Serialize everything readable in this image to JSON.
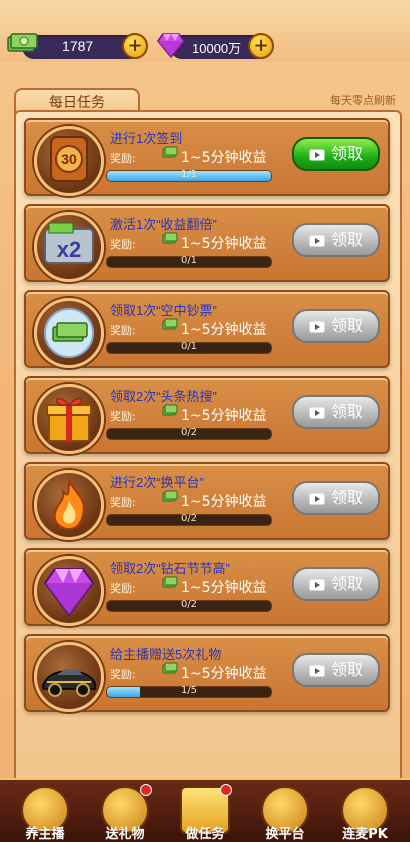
{
  "currency": {
    "cash_value": "1787",
    "gem_value": "10000万"
  },
  "tab": {
    "label": "每日任务"
  },
  "refresh_note": "每天零点刷新",
  "reward_label": "奖励:",
  "tasks": [
    {
      "title": "进行1次签到",
      "reward": "1~5分钟收益",
      "progress_text": "1/1",
      "progress": 1.0,
      "button": "领取",
      "button_state": "active",
      "icon": "sign-in-30-icon"
    },
    {
      "title": "激活1次“收益翻倍”",
      "reward": "1~5分钟收益",
      "progress_text": "0/1",
      "progress": 0,
      "button": "领取",
      "button_state": "inactive",
      "icon": "double-x2-icon"
    },
    {
      "title": "领取1次“空中钞票”",
      "reward": "1~5分钟收益",
      "progress_text": "0/1",
      "progress": 0,
      "button": "领取",
      "button_state": "inactive",
      "icon": "cash-bubble-icon"
    },
    {
      "title": "领取2次“头条热搜”",
      "reward": "1~5分钟收益",
      "progress_text": "0/2",
      "progress": 0,
      "button": "领取",
      "button_state": "inactive",
      "icon": "gift-box-icon"
    },
    {
      "title": "进行2次“换平台”",
      "reward": "1~5分钟收益",
      "progress_text": "0/2",
      "progress": 0,
      "button": "领取",
      "button_state": "inactive",
      "icon": "fire-icon"
    },
    {
      "title": "领取2次“钻石节节高”",
      "reward": "1~5分钟收益",
      "progress_text": "0/2",
      "progress": 0,
      "button": "领取",
      "button_state": "inactive",
      "icon": "diamond-icon"
    },
    {
      "title": "给主播赠送5次礼物",
      "reward": "1~5分钟收益",
      "progress_text": "1/5",
      "progress": 0.2,
      "button": "领取",
      "button_state": "inactive",
      "icon": "sports-car-icon"
    }
  ],
  "nav": [
    {
      "label": "养主播",
      "badge": false,
      "active": false
    },
    {
      "label": "送礼物",
      "badge": true,
      "active": false
    },
    {
      "label": "做任务",
      "badge": true,
      "active": true
    },
    {
      "label": "换平台",
      "badge": false,
      "active": false
    },
    {
      "label": "连麦PK",
      "badge": false,
      "active": false
    }
  ],
  "colors": {
    "title_blue": "#2a35b8",
    "button_green": "#1fae18",
    "button_gray": "#b7b7b7",
    "progress_blue": "#3aa7e6"
  }
}
